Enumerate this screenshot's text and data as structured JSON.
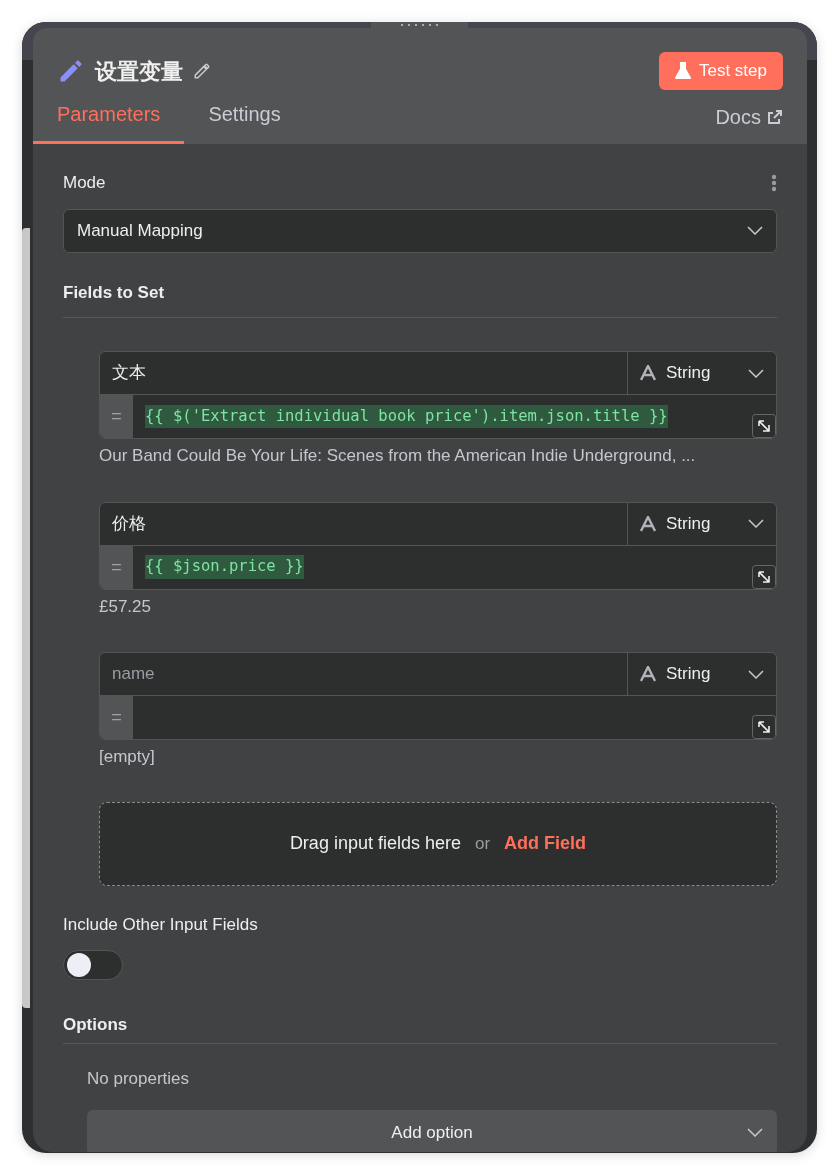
{
  "header": {
    "title": "设置变量",
    "test_button": "Test step"
  },
  "tabs": [
    {
      "label": "Parameters",
      "selected": true
    },
    {
      "label": "Settings",
      "selected": false
    }
  ],
  "docs_link": "Docs",
  "mode": {
    "label": "Mode",
    "value": "Manual Mapping"
  },
  "fields_section": {
    "title": "Fields to Set"
  },
  "fields": [
    {
      "name": "文本",
      "type": "String",
      "equals": "=",
      "expression": "{{ $('Extract individual book price').item.json.title }}",
      "result": "Our Band Could Be Your Life: Scenes from the American Indie Underground, ..."
    },
    {
      "name": "价格",
      "type": "String",
      "equals": "=",
      "expression": "{{ $json.price }}",
      "result": "£57.25"
    },
    {
      "placeholder": "name",
      "type": "String",
      "equals": "=",
      "result": "[empty]"
    }
  ],
  "drop_zone": {
    "text": "Drag input fields here",
    "or": "or",
    "action": "Add Field"
  },
  "include_other": {
    "label": "Include Other Input Fields",
    "on": false
  },
  "options": {
    "title": "Options",
    "empty_text": "No properties",
    "add_button": "Add option"
  }
}
